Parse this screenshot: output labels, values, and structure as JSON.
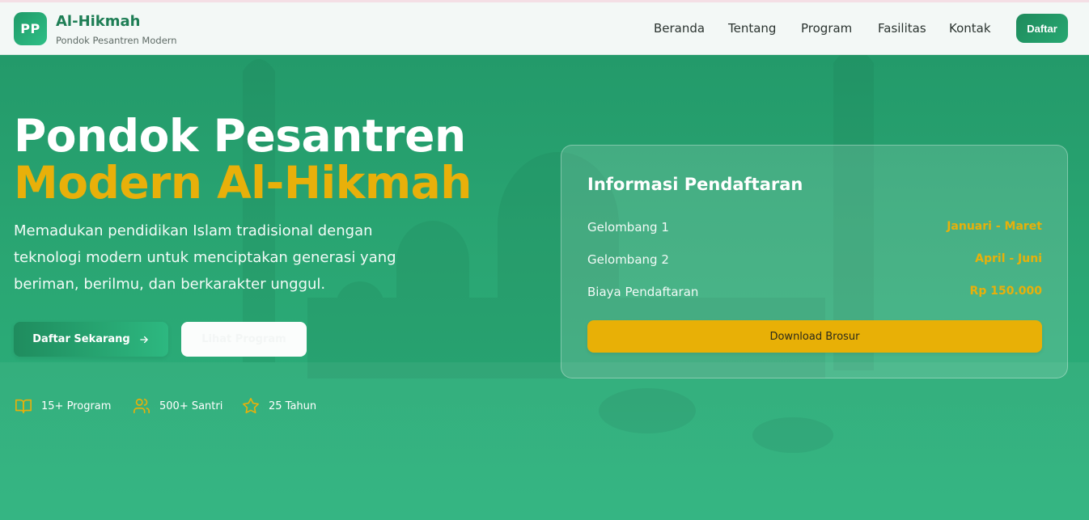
{
  "brand": {
    "logo_initials": "PP",
    "name": "Al-Hikmah",
    "tagline": "Pondok Pesantren Modern"
  },
  "nav": {
    "links": [
      "Beranda",
      "Tentang",
      "Program",
      "Fasilitas",
      "Kontak"
    ],
    "cta": "Daftar"
  },
  "hero": {
    "title_line1": "Pondok Pesantren",
    "title_line2": "Modern Al-Hikmah",
    "description": "Memadukan pendidikan Islam tradisional dengan teknologi modern untuk menciptakan generasi yang beriman, berilmu, dan berkarakter unggul.",
    "primary_button": "Daftar Sekarang",
    "secondary_button": "Lihat Program",
    "stats": [
      {
        "icon": "book-icon",
        "label": "15+ Program"
      },
      {
        "icon": "users-icon",
        "label": "500+ Santri"
      },
      {
        "icon": "star-icon",
        "label": "25 Tahun"
      }
    ]
  },
  "registration": {
    "title": "Informasi Pendaftaran",
    "rows": [
      {
        "label": "Gelombang 1",
        "value": "Januari - Maret"
      },
      {
        "label": "Gelombang 2",
        "value": "April - Juni"
      },
      {
        "label": "Biaya Pendaftaran",
        "value": "Rp 150.000"
      }
    ],
    "button": "Download Brosur"
  },
  "colors": {
    "primary_green": "#1e8a5c",
    "accent_gold": "#e8b00a",
    "hero_bg": "#2aa872"
  }
}
